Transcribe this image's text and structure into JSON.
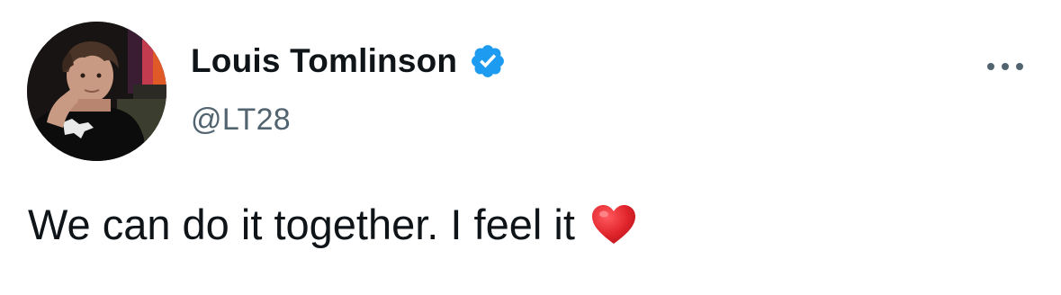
{
  "tweet": {
    "author": {
      "display_name": "Louis Tomlinson",
      "handle": "@LT28",
      "verified": true,
      "verified_icon": "verified-badge-icon",
      "avatar": "profile-photo"
    },
    "text": "We can do it together. I feel it",
    "emoji": "red-heart",
    "more_icon": "more-options-icon"
  },
  "colors": {
    "text_primary": "#0f1419",
    "text_secondary": "#536471",
    "verified_blue": "#1d9bf0",
    "heart_red": "#e0242b",
    "background": "#ffffff"
  }
}
